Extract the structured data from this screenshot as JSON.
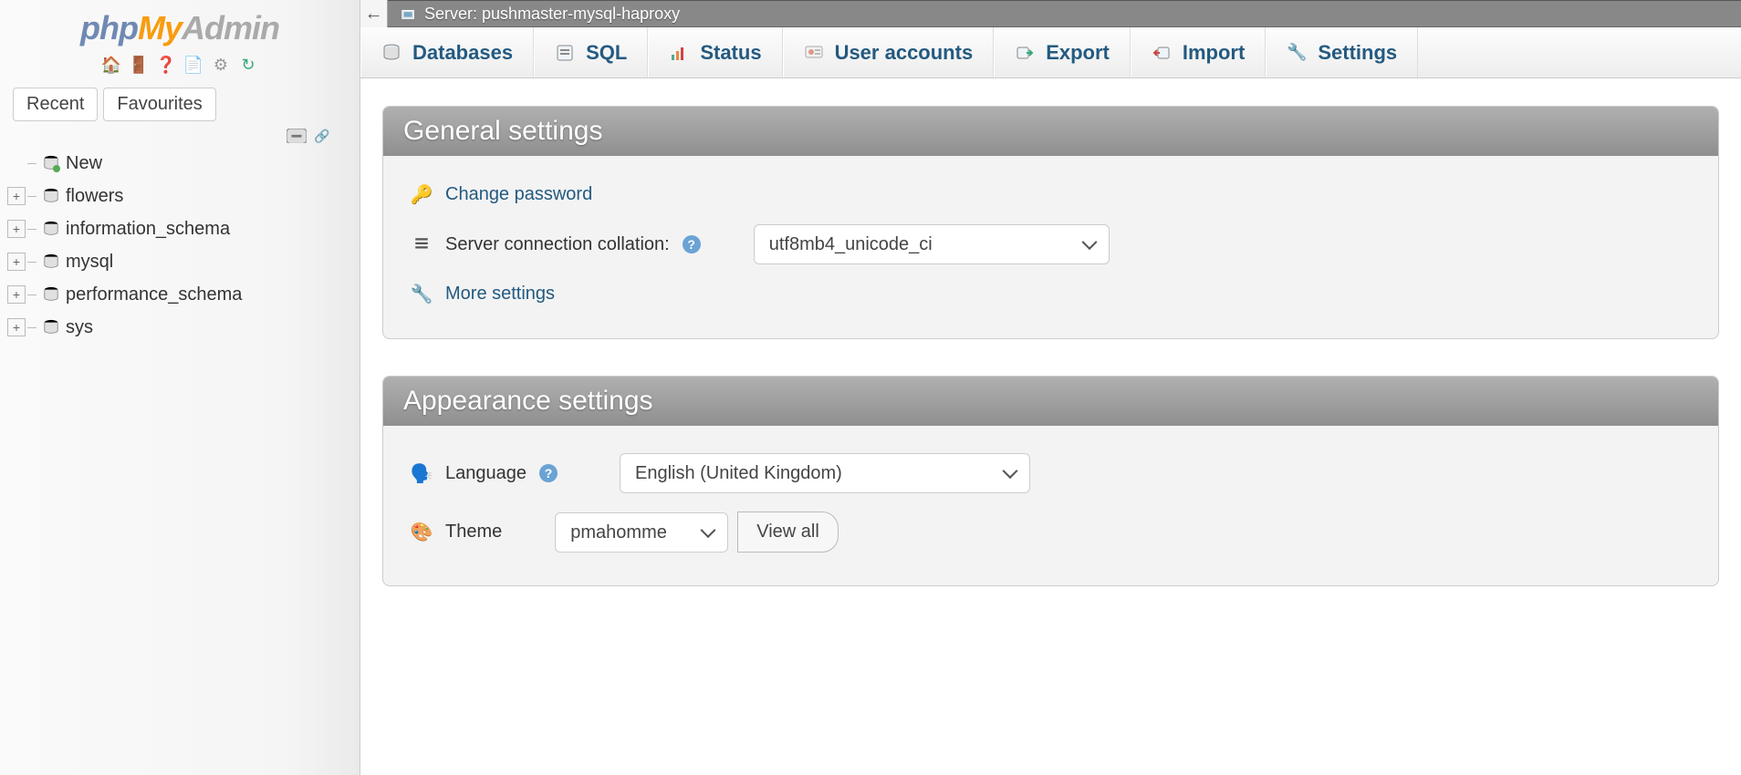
{
  "logo": {
    "p1": "php",
    "p2": "My",
    "p3": "Admin"
  },
  "sidebar": {
    "tabs": {
      "recent": "Recent",
      "favourites": "Favourites"
    },
    "tree": {
      "new": "New",
      "items": [
        {
          "label": "flowers"
        },
        {
          "label": "information_schema"
        },
        {
          "label": "mysql"
        },
        {
          "label": "performance_schema"
        },
        {
          "label": "sys"
        }
      ]
    }
  },
  "breadcrumb": {
    "server_prefix": "Server: ",
    "server_name": "pushmaster-mysql-haproxy"
  },
  "topnav": [
    {
      "label": "Databases",
      "icon": "db"
    },
    {
      "label": "SQL",
      "icon": "sql"
    },
    {
      "label": "Status",
      "icon": "status"
    },
    {
      "label": "User accounts",
      "icon": "users"
    },
    {
      "label": "Export",
      "icon": "export"
    },
    {
      "label": "Import",
      "icon": "import"
    },
    {
      "label": "Settings",
      "icon": "settings"
    }
  ],
  "panels": {
    "general": {
      "title": "General settings",
      "change_password": "Change password",
      "collation_label": "Server connection collation:",
      "collation_value": "utf8mb4_unicode_ci",
      "more_settings": "More settings"
    },
    "appearance": {
      "title": "Appearance settings",
      "language_label": "Language",
      "language_value": "English (United Kingdom)",
      "theme_label": "Theme",
      "theme_value": "pmahomme",
      "view_all": "View all"
    }
  }
}
